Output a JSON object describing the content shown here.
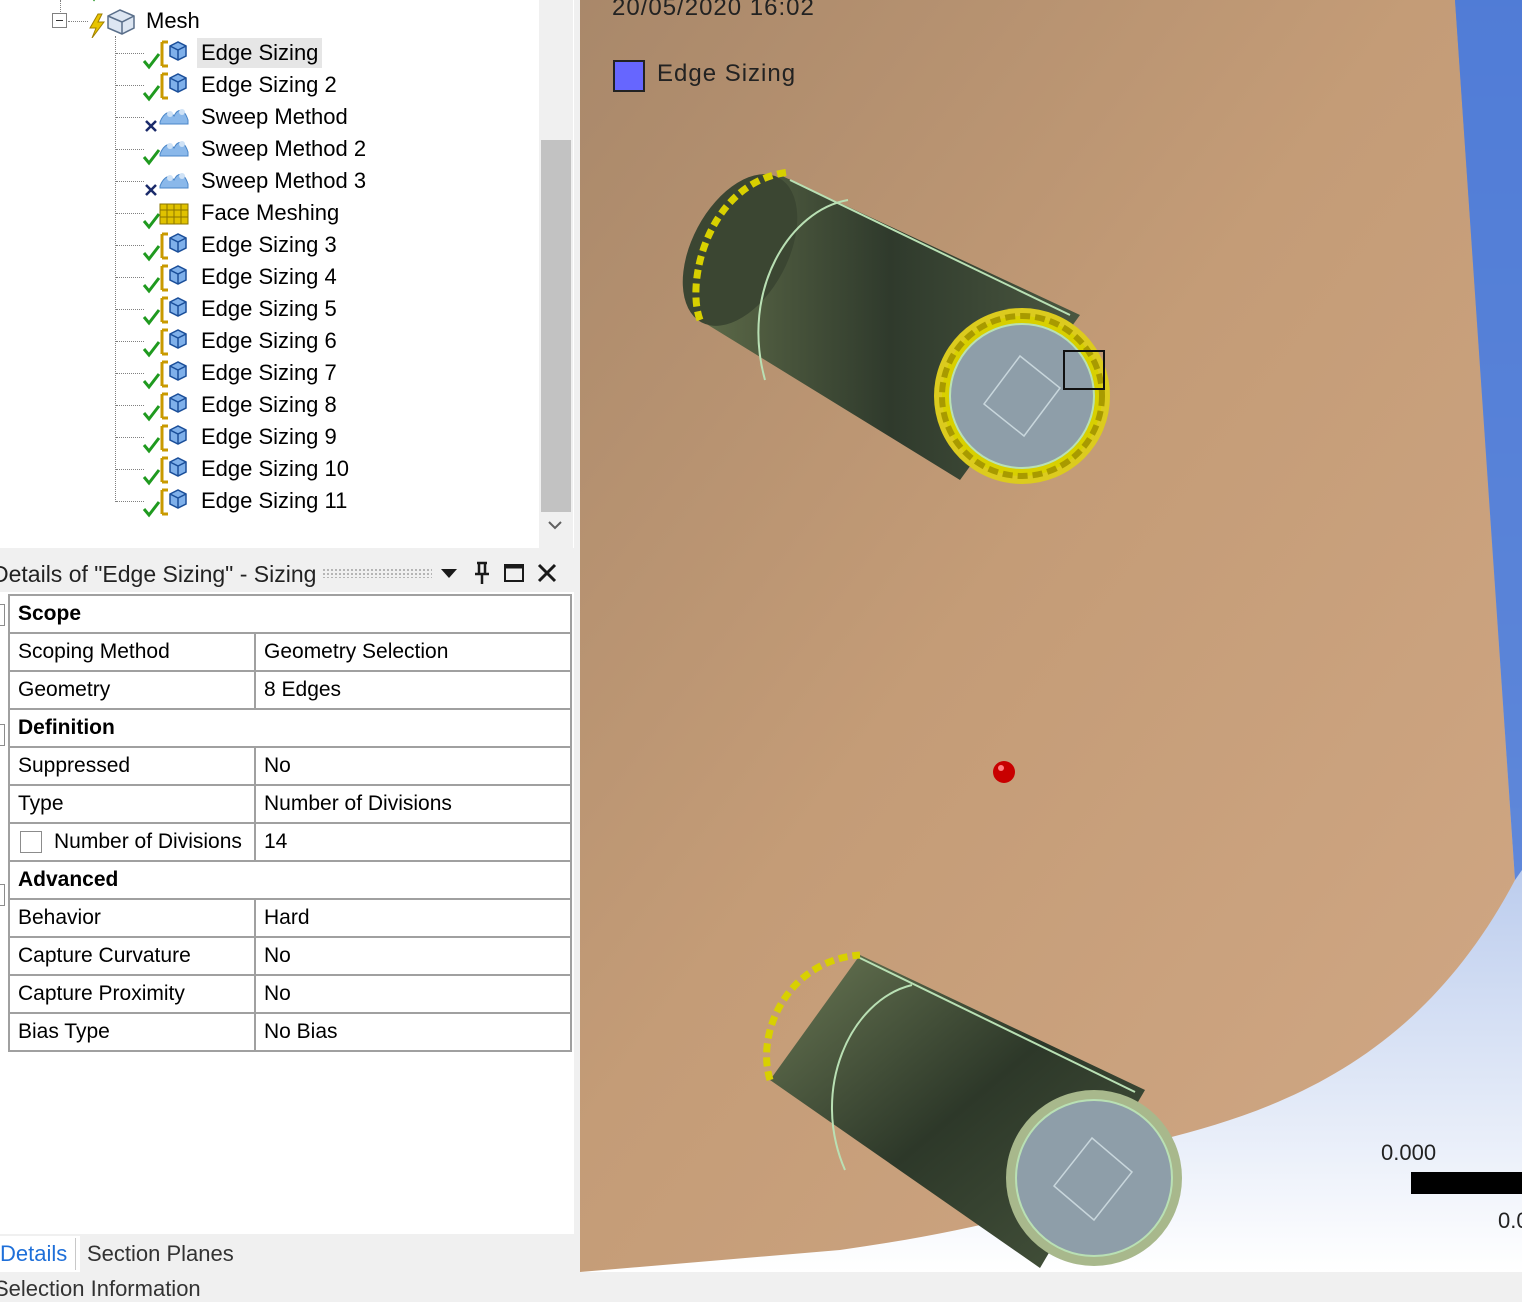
{
  "tree": {
    "root_label": "Mesh",
    "items": [
      {
        "label": "Edge Sizing",
        "icon": "edge-sizing-icon",
        "status": "ok",
        "selected": true
      },
      {
        "label": "Edge Sizing 2",
        "icon": "edge-sizing-icon",
        "status": "ok"
      },
      {
        "label": "Sweep Method",
        "icon": "sweep-method-icon",
        "status": "suppressed"
      },
      {
        "label": "Sweep Method 2",
        "icon": "sweep-method-icon",
        "status": "ok"
      },
      {
        "label": "Sweep Method 3",
        "icon": "sweep-method-icon",
        "status": "suppressed"
      },
      {
        "label": "Face Meshing",
        "icon": "face-meshing-icon",
        "status": "ok"
      },
      {
        "label": "Edge Sizing 3",
        "icon": "edge-sizing-icon",
        "status": "ok"
      },
      {
        "label": "Edge Sizing 4",
        "icon": "edge-sizing-icon",
        "status": "ok"
      },
      {
        "label": "Edge Sizing 5",
        "icon": "edge-sizing-icon",
        "status": "ok"
      },
      {
        "label": "Edge Sizing 6",
        "icon": "edge-sizing-icon",
        "status": "ok"
      },
      {
        "label": "Edge Sizing 7",
        "icon": "edge-sizing-icon",
        "status": "ok"
      },
      {
        "label": "Edge Sizing 8",
        "icon": "edge-sizing-icon",
        "status": "ok"
      },
      {
        "label": "Edge Sizing 9",
        "icon": "edge-sizing-icon",
        "status": "ok"
      },
      {
        "label": "Edge Sizing 10",
        "icon": "edge-sizing-icon",
        "status": "ok"
      },
      {
        "label": "Edge Sizing 11",
        "icon": "edge-sizing-icon",
        "status": "ok"
      }
    ]
  },
  "details": {
    "title": "Details of \"Edge Sizing\" - Sizing",
    "buttons": {
      "dropdown": "chevron-down-icon",
      "pin": "pin-icon",
      "maximize": "maximize-icon",
      "close": "close-icon"
    },
    "sections": {
      "scope": "Scope",
      "definition": "Definition",
      "advanced": "Advanced"
    },
    "rows": {
      "scoping_method": {
        "label": "Scoping Method",
        "value": "Geometry Selection"
      },
      "geometry": {
        "label": "Geometry",
        "value": "8 Edges"
      },
      "suppressed": {
        "label": "Suppressed",
        "value": "No"
      },
      "type": {
        "label": "Type",
        "value": "Number of Divisions"
      },
      "number_of_divisions": {
        "label": "Number of Divisions",
        "value": "14"
      },
      "behavior": {
        "label": "Behavior",
        "value": "Hard"
      },
      "capture_curvature": {
        "label": "Capture Curvature",
        "value": "No"
      },
      "capture_proximity": {
        "label": "Capture Proximity",
        "value": "No"
      },
      "bias_type": {
        "label": "Bias Type",
        "value": "No Bias"
      }
    }
  },
  "tabs": {
    "details": "Details",
    "section_planes": "Section Planes",
    "selection_information": "Selection Information"
  },
  "viewport": {
    "timestamp": "20/05/2020 16:02",
    "legend_label": "Edge Sizing",
    "legend_color": "#6666ff",
    "scale_top": "0.000",
    "scale_bottom": "0.0"
  },
  "colors": {
    "body_face": "#c29a74",
    "cylinder": "#4d5a3e",
    "cylinder_cap": "#8a9aa6",
    "edge_highlight": "#e8d800",
    "background_blue": "#5f86d8"
  }
}
